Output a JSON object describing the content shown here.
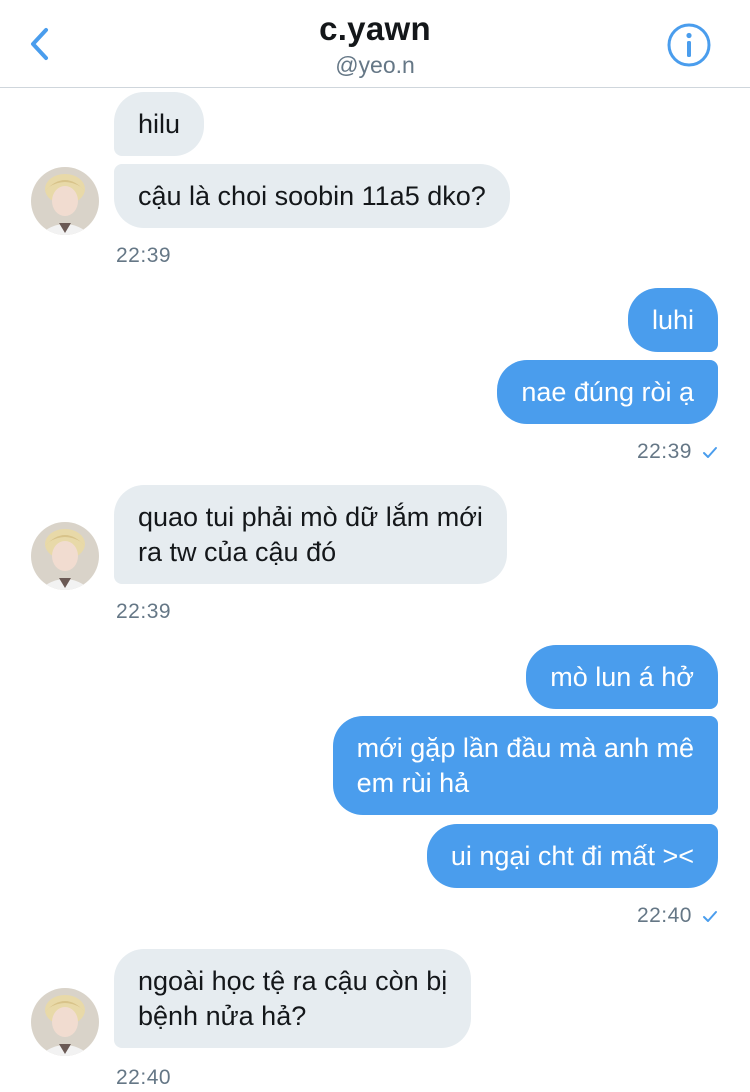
{
  "header": {
    "title": "c.yawn",
    "handle": "@yeo.n",
    "back_icon": "chevron-left-icon",
    "info_icon": "info-icon"
  },
  "messages": [
    {
      "direction": "in",
      "text": "hilu"
    },
    {
      "direction": "in",
      "text": "cậu là choi soobin 11a5 dko?"
    },
    {
      "direction": "in",
      "time": "22:39"
    },
    {
      "direction": "out",
      "text": "luhi"
    },
    {
      "direction": "out",
      "text": "nae đúng ròi ạ"
    },
    {
      "direction": "out",
      "time": "22:39"
    },
    {
      "direction": "in",
      "text": "quao tui phải mò dữ lắm mới\nra tw của cậu đó"
    },
    {
      "direction": "in",
      "time": "22:39"
    },
    {
      "direction": "out",
      "text": "mò lun á hở"
    },
    {
      "direction": "out",
      "text": "mới gặp lần đầu mà anh mê\nem rùi hả"
    },
    {
      "direction": "out",
      "text": "ui ngại cht đi mất ><"
    },
    {
      "direction": "out",
      "time": "22:40"
    },
    {
      "direction": "in",
      "text": "ngoài học tệ ra cậu còn bị\nbệnh nửa hả?"
    },
    {
      "direction": "in",
      "time": "22:40"
    }
  ],
  "colors": {
    "accent": "#4a9ded",
    "incoming_bubble": "#e6ecf0",
    "secondary_text": "#657786"
  }
}
